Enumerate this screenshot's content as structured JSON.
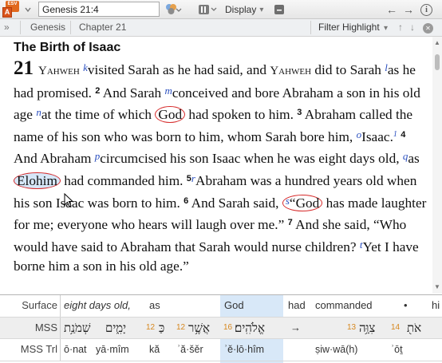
{
  "toolbar": {
    "app_badge_top": "ESV",
    "app_badge_letter": "A",
    "reference_value": "Genesis 21:4",
    "display_label": "Display",
    "dropdown_arrow": "▾",
    "back_arrow": "←",
    "forward_arrow": "→",
    "info_glyph": "i"
  },
  "breadcrumb": {
    "expander": "»",
    "book": "Genesis",
    "chapter": "Chapter 21",
    "filter_label": "Filter Highlight",
    "filter_arrow": "▾",
    "up_arrow": "↑",
    "down_arrow": "↓",
    "close": "✕"
  },
  "passage": {
    "heading": "The Birth of Isaac",
    "chapter_number": "21",
    "yahweh": "Yahweh",
    "v1": {
      "xr_k": "k",
      "t1": "visited Sarah as he had said, and ",
      "t2": " did to Sarah ",
      "xr_l": "l",
      "t3": "as he had promised. "
    },
    "v2": {
      "num": "2",
      "t1": " And Sarah ",
      "xr_m": "m",
      "t2": "conceived and bore Abraham a son in his old age ",
      "xr_n": "n",
      "t3": "at the time of which ",
      "god": "God",
      "t4": " had spoken to him. "
    },
    "v3": {
      "num": "3",
      "t1": " Abraham called the name of his son who was born to him, whom Sarah bore him, ",
      "xr_o": "o",
      "t2": "Isaac.",
      "fn1": "1",
      "t3": " "
    },
    "v4": {
      "num": "4",
      "t1": " And Abraham ",
      "xr_p": "p",
      "t2": "circumcised his son Isaac when he was eight days old, ",
      "xr_q": "q",
      "t3": "as ",
      "elohim": "Elohim",
      "t4": " had commanded him. "
    },
    "v5": {
      "num": "5",
      "xr_r": "r",
      "t1": "Abraham was a hundred years old when his son Isaac was born to him. "
    },
    "v6": {
      "num": "6",
      "t1": " And Sarah said, ",
      "xr_s": "s",
      "quote_open": "“",
      "god": "God",
      "t2": " has made laughter for me; everyone who hears will laugh over me.” "
    },
    "v7": {
      "num": "7",
      "t1": " And she said, “Who would have said to Abraham that Sarah would nurse children? ",
      "xr_t": "t",
      "t2": "Yet I have borne him a son in his old age.”"
    }
  },
  "interlinear": {
    "labels": [
      "Surface",
      "MSS",
      "MSS Trl"
    ],
    "surface": [
      "eight days old,",
      "as",
      "God",
      "had",
      "commanded",
      "•",
      "hi"
    ],
    "mss": [
      {
        "num": "",
        "heb": "שְׁמֹנַ֥ת"
      },
      {
        "num": "",
        "heb": "יָמִ֑ים"
      },
      {
        "num": "12",
        "heb": "כַּ"
      },
      {
        "num": "12",
        "heb": "אֲשֶׁ֥ר"
      },
      {
        "num": "16",
        "heb": "אֱלֹהִֽים׃"
      },
      {
        "num": "",
        "heb": "→"
      },
      {
        "num": "13",
        "heb": "צִוָּ֥ה"
      },
      {
        "num": "14",
        "heb": "אֹת֖"
      }
    ],
    "trl": [
      "ō·nat",
      "yā·mîm",
      "kă",
      "ʾă·šěr",
      "ʾě·lō·hîm",
      "ṣiw·wā(h)",
      "ʾōṯ"
    ]
  }
}
